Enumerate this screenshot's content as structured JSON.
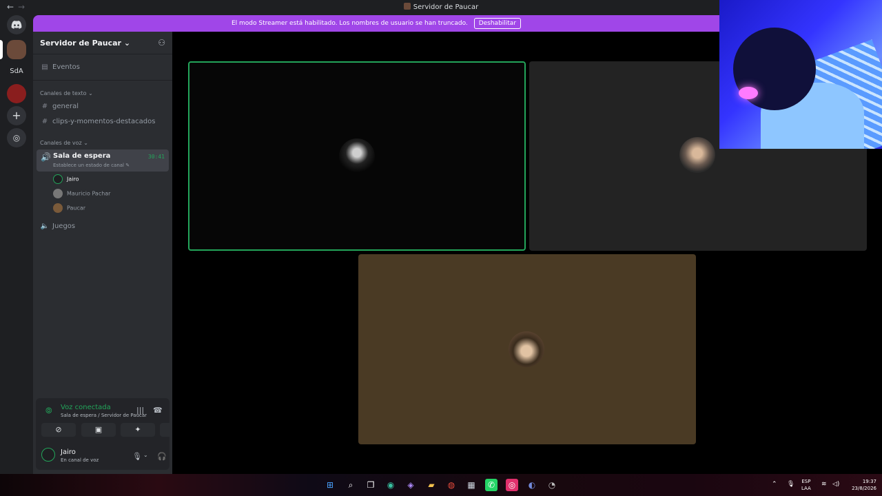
{
  "titlebar": {
    "title": "Servidor de Paucar",
    "back": "←",
    "forward": "→"
  },
  "banner": {
    "text": "El modo Streamer está habilitado. Los nombres de usuario se han truncado.",
    "button": "Deshabilitar"
  },
  "rail": {
    "items": [
      "discord-home",
      "server-paucar",
      "SdA",
      "server-red",
      "add-server",
      "explore"
    ],
    "sda_label": "SdA"
  },
  "sidebar": {
    "server_name": "Servidor de Paucar",
    "events": "Eventos",
    "text_category": "Canales de texto",
    "text_channels": [
      "general",
      "clips-y-momentos-destacados"
    ],
    "voice_category": "Canales de voz",
    "active_voice": {
      "name": "Sala de espera",
      "status": "Establece un estado de canal",
      "timer": "30:41"
    },
    "members": [
      "Jairo",
      "Mauricio Pachar",
      "Paucar"
    ],
    "other_voice": "Juegos"
  },
  "voice_panel": {
    "status": "Voz conectada",
    "location": "Sala de espera / Servidor de Paucar",
    "user_name": "Jairo",
    "user_status": "En canal de voz"
  },
  "taskbar": {
    "lang_top": "ESP",
    "lang_bottom": "LAA",
    "time": "19:37",
    "date": "23/8/2026"
  },
  "colors": {
    "accent_green": "#23a55a",
    "banner_purple": "#a046e8",
    "tile_brown": "#4a3a24"
  }
}
